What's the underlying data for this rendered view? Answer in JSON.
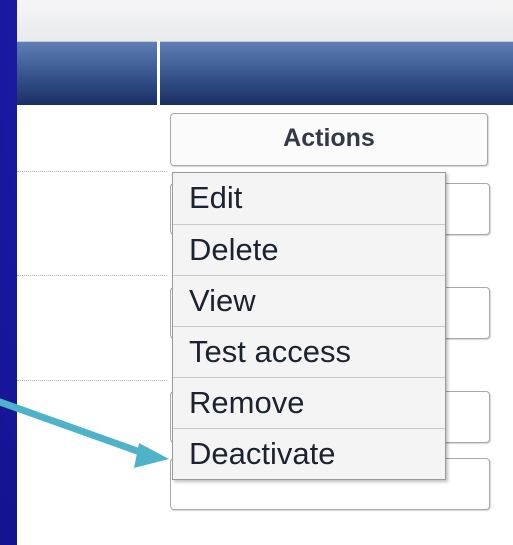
{
  "actions": {
    "header_label": "Actions",
    "menu_items": [
      "Edit",
      "Delete",
      "View",
      "Test access",
      "Remove",
      "Deactivate"
    ]
  },
  "colors": {
    "slide_background": "#1f1fa8",
    "header_bar": "#2c4a85",
    "arrow": "#4eb3c9"
  },
  "icons": {
    "pointer_arrow": "arrow-icon"
  }
}
